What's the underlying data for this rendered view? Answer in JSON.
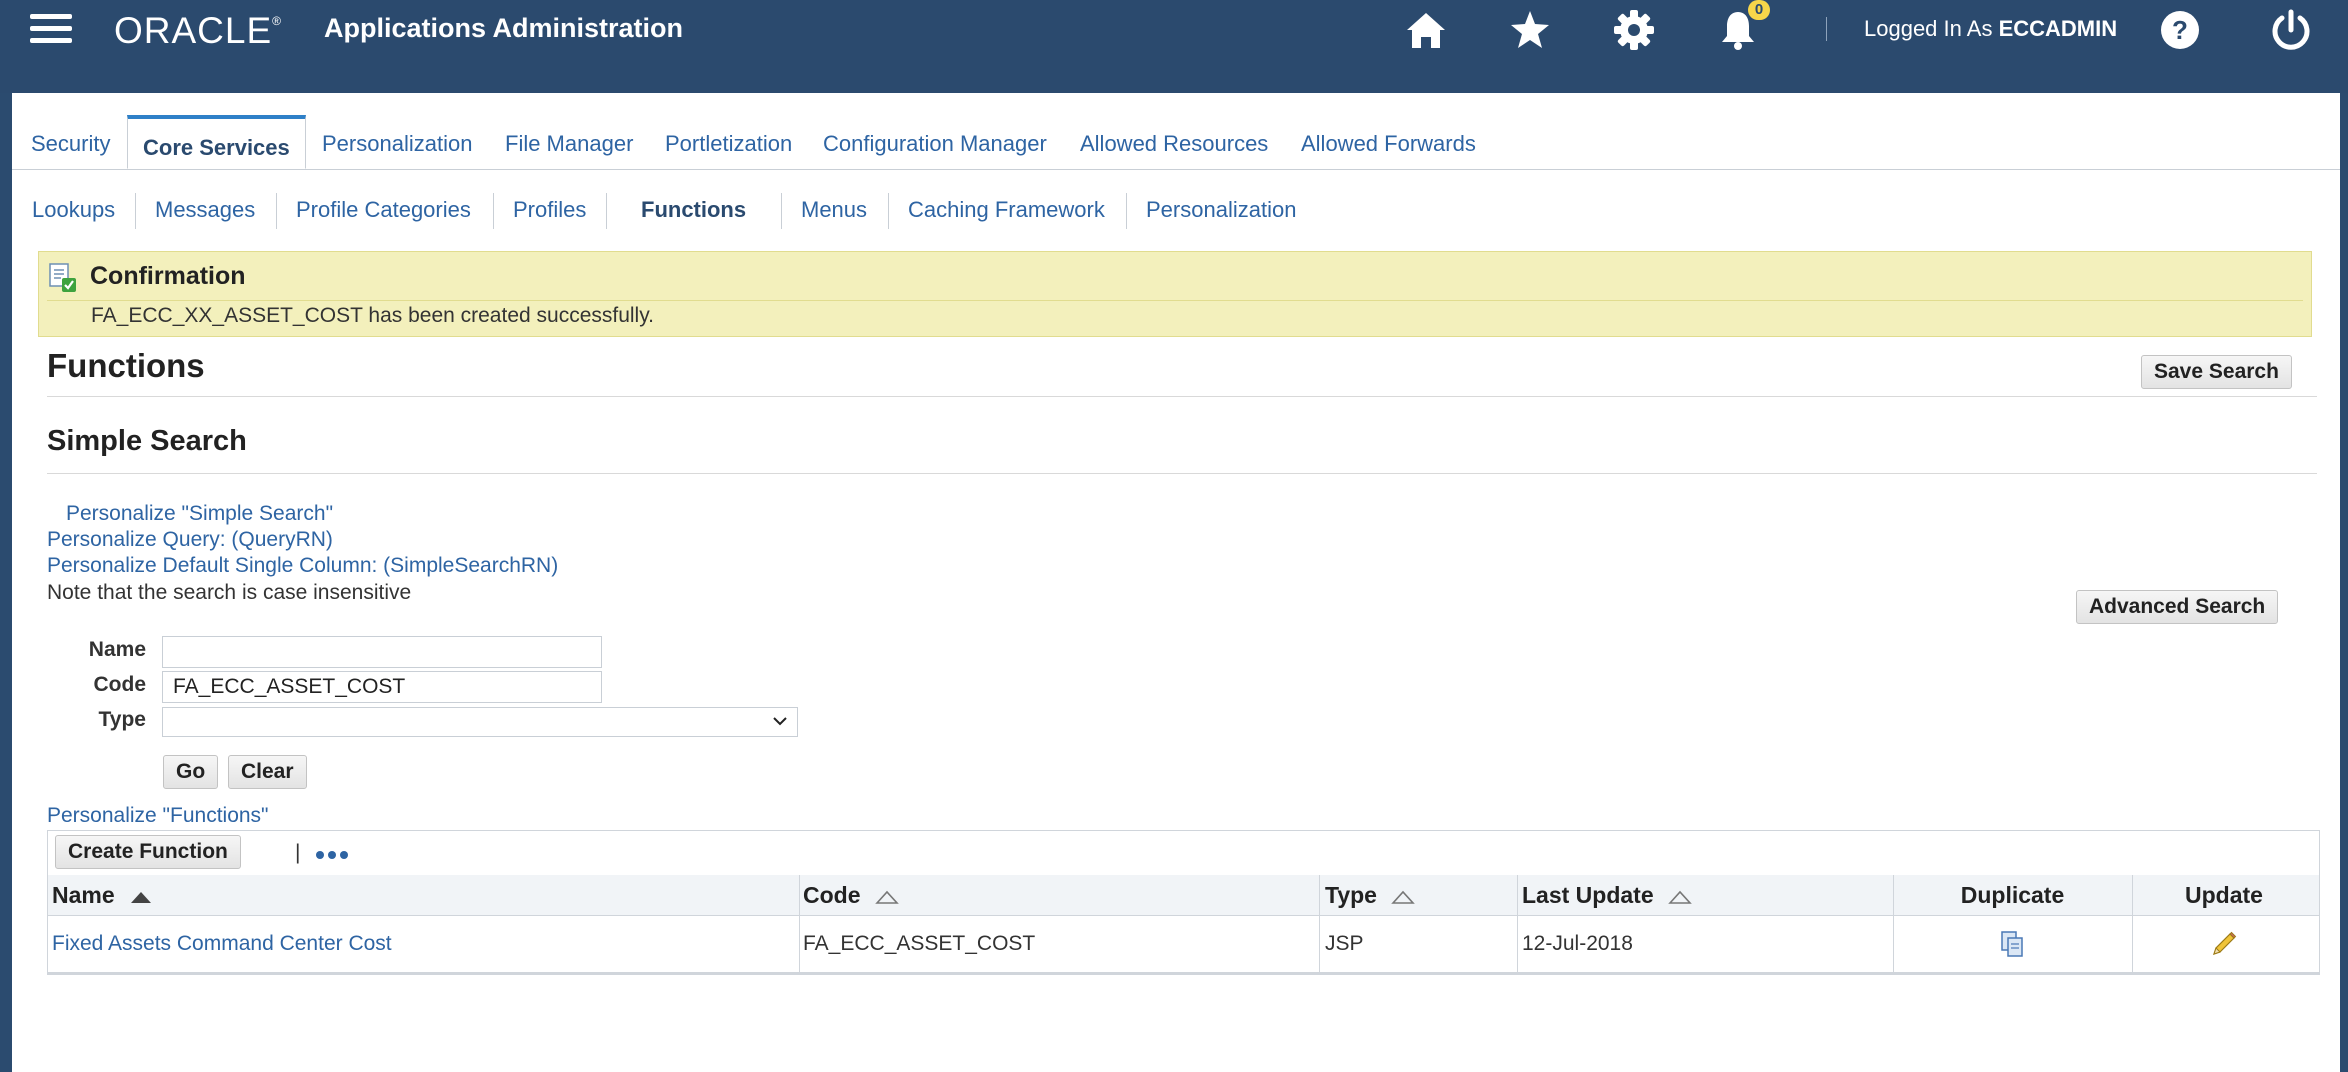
{
  "header": {
    "logo": "ORACLE",
    "logo_mark": "®",
    "app_title": "Applications Administration",
    "notifications_count": "0",
    "logged_in_prefix": "Logged In As",
    "username": "ECCADMIN",
    "icons": [
      "menu-icon",
      "home-icon",
      "star-icon",
      "gear-icon",
      "bell-icon",
      "help-icon",
      "power-icon"
    ]
  },
  "tabs": [
    "Security",
    "Core Services",
    "Personalization",
    "File Manager",
    "Portletization",
    "Configuration Manager",
    "Allowed Resources",
    "Allowed Forwards"
  ],
  "active_tab": "Core Services",
  "subtabs": [
    "Lookups",
    "Messages",
    "Profile Categories",
    "Profiles",
    "Functions",
    "Menus",
    "Caching Framework",
    "Personalization"
  ],
  "active_subtab": "Functions",
  "confirmation": {
    "title": "Confirmation",
    "message": "FA_ECC_XX_ASSET_COST has been created successfully."
  },
  "page": {
    "title": "Functions",
    "save_search": "Save Search",
    "section_title": "Simple Search",
    "personalize_simple_search": "Personalize \"Simple Search\"",
    "personalize_query": "Personalize Query: (QueryRN)",
    "personalize_default_column": "Personalize Default Single Column: (SimpleSearchRN)",
    "note": "Note that the search is case insensitive",
    "advanced_search": "Advanced Search"
  },
  "search": {
    "name_label": "Name",
    "name_value": "",
    "code_label": "Code",
    "code_value": "FA_ECC_ASSET_COST",
    "type_label": "Type",
    "type_value": "",
    "go": "Go",
    "clear": "Clear"
  },
  "results": {
    "personalize_link": "Personalize \"Functions\"",
    "create_button": "Create Function",
    "separator": "|",
    "columns": [
      "Name",
      "Code",
      "Type",
      "Last Update",
      "Duplicate",
      "Update"
    ],
    "sorted_column": "Name",
    "rows": [
      {
        "name": "Fixed Assets Command Center Cost",
        "code": "FA_ECC_ASSET_COST",
        "type": "JSP",
        "last_update": "12-Jul-2018",
        "duplicate_icon": "duplicate-icon",
        "update_icon": "pencil-icon"
      }
    ]
  },
  "colors": {
    "header_bg": "#2b4a6e",
    "link": "#2e64a3",
    "confirm_bg": "#f3f0bc",
    "badge": "#f7d64a"
  }
}
